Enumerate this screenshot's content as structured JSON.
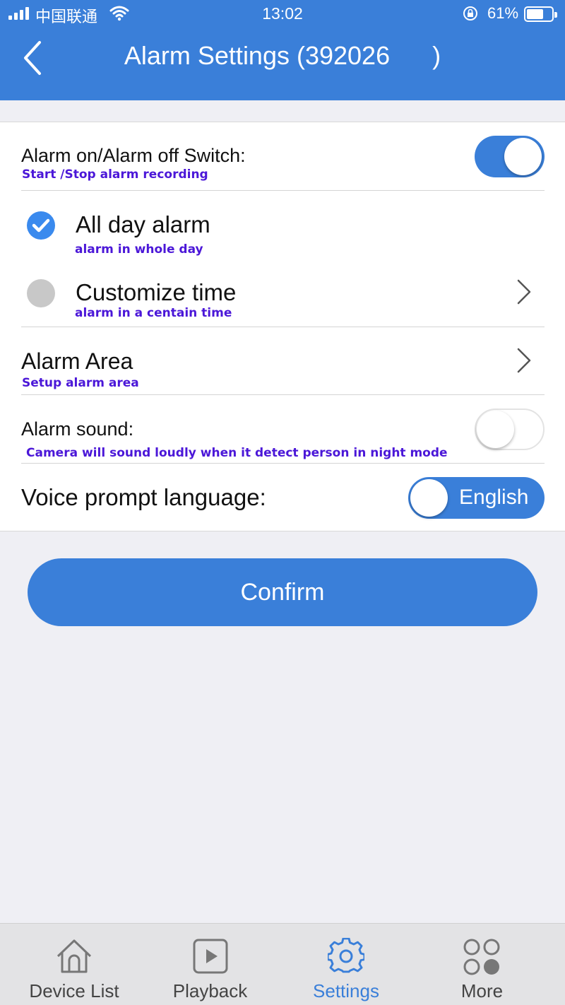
{
  "status_bar": {
    "carrier": "中国联通",
    "time": "13:02",
    "battery": "61%"
  },
  "header": {
    "title": "Alarm Settings (392026      )"
  },
  "settings": {
    "alarm_switch": {
      "label": "Alarm on/Alarm off Switch:",
      "sub": "Start /Stop alarm recording",
      "on": true
    },
    "all_day": {
      "label": "All day alarm",
      "sub": "alarm in whole day",
      "selected": true
    },
    "customize": {
      "label": "Customize time",
      "sub": "alarm in a centain time",
      "selected": false
    },
    "alarm_area": {
      "label": "Alarm Area",
      "sub": "Setup alarm area"
    },
    "alarm_sound": {
      "label": "Alarm sound:",
      "sub": "Camera will sound loudly when it detect person in night mode",
      "on": false
    },
    "voice_prompt": {
      "label": "Voice prompt language:",
      "value": "English"
    }
  },
  "confirm_label": "Confirm",
  "tabbar": {
    "tabs": [
      {
        "label": "Device List",
        "icon": "home-icon"
      },
      {
        "label": "Playback",
        "icon": "play-icon"
      },
      {
        "label": "Settings",
        "icon": "gear-icon",
        "active": true
      },
      {
        "label": "More",
        "icon": "more-icon"
      }
    ]
  },
  "colors": {
    "primary": "#3a7fd9",
    "sub_text": "#4b17d8",
    "radio_on": "#3a8aee",
    "radio_off": "#c8c8c8"
  }
}
